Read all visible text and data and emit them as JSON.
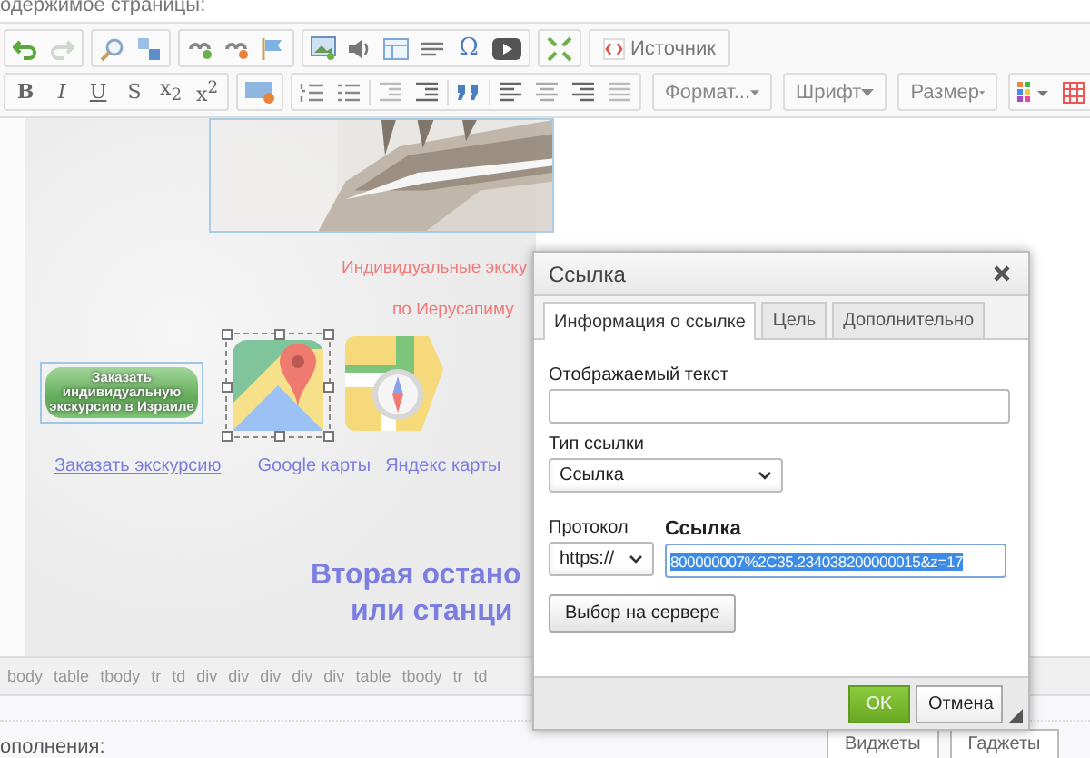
{
  "page_label": "одержимое страницы:",
  "toolbar": {
    "redo_disabled": true,
    "omega": "Ω",
    "source_button": "Источник",
    "format_buttons": [
      "B",
      "I",
      "U",
      "S",
      "x$_{2}$",
      "x$^{2}$"
    ],
    "dropdowns": [
      "Формат...",
      "Шрифт",
      "Размер"
    ]
  },
  "editor": {
    "order_button": "Заказать индивидуальную экскурсию в Израиле",
    "red_lines": [
      "Индивидуальные экску",
      "по Иерусапиму"
    ],
    "links": [
      "Заказать экскурсию",
      "Google карты",
      "Яндекс карты"
    ],
    "heading_lines": [
      "Вторая остано",
      "или станци"
    ]
  },
  "path": [
    "body",
    "table",
    "tbody",
    "tr",
    "td",
    "div",
    "div",
    "div",
    "div",
    "div",
    "table",
    "tbody",
    "tr",
    "td"
  ],
  "bottom_label": "ополнения:",
  "bottom_buttons": [
    "Виджеты",
    "Гаджеты"
  ],
  "dialog": {
    "title": "Ссылка",
    "tabs": [
      {
        "label": "Информация о ссылке",
        "selected": true
      },
      {
        "label": "Цель",
        "selected": false
      },
      {
        "label": "Дополнительно",
        "selected": false
      }
    ],
    "display_text_label": "Отображаемый текст",
    "link_type_label": "Тип ссылки",
    "link_type": "Ссылка",
    "protocol_label": "Протокол",
    "protocol": "https://",
    "url_label": "Ссылка",
    "url": "800000007%2C35.234038200000015&z=17",
    "server_button": "Выбор на сервере",
    "ok": "OK",
    "cancel": "Отмена"
  }
}
